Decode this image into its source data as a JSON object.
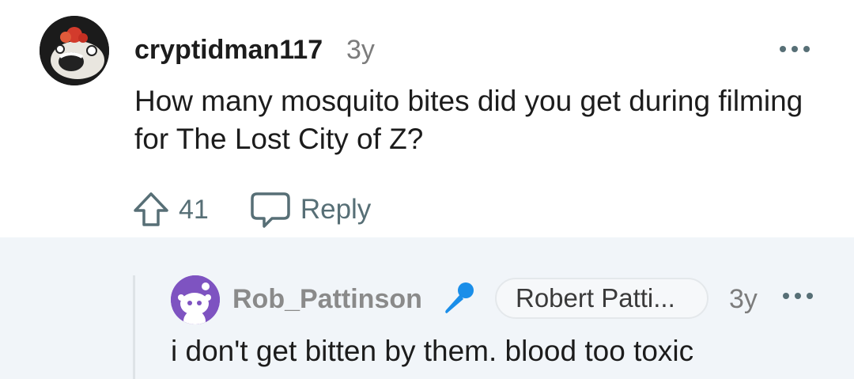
{
  "comment": {
    "username": "cryptidman117",
    "age": "3y",
    "body": "How many mosquito bites did you get during filming for The Lost City of Z?",
    "votes": "41",
    "reply_label": "Reply"
  },
  "reply": {
    "username": "Rob_Pattinson",
    "flair": "Robert Patti...",
    "age": "3y",
    "body": "i don't get bitten by them. blood too toxic"
  },
  "colors": {
    "reply_background": "#f1f5f9",
    "mic_icon": "#1a8ee9",
    "avatar_purple": "#7e53c1"
  },
  "icons": [
    "upvote-icon",
    "reply-bubble-icon",
    "more-options-icon",
    "microphone-icon"
  ]
}
